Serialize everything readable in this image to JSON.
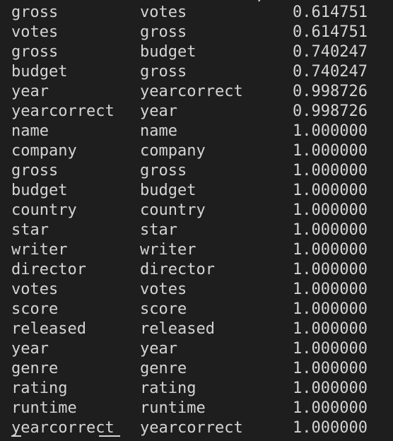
{
  "rows": [
    {
      "var1": "gross",
      "var2": "votes",
      "corr": "0.614751"
    },
    {
      "var1": "votes",
      "var2": "gross",
      "corr": "0.614751"
    },
    {
      "var1": "gross",
      "var2": "budget",
      "corr": "0.740247"
    },
    {
      "var1": "budget",
      "var2": "gross",
      "corr": "0.740247"
    },
    {
      "var1": "year",
      "var2": "yearcorrect",
      "corr": "0.998726"
    },
    {
      "var1": "yearcorrect",
      "var2": "year",
      "corr": "0.998726"
    },
    {
      "var1": "name",
      "var2": "name",
      "corr": "1.000000"
    },
    {
      "var1": "company",
      "var2": "company",
      "corr": "1.000000"
    },
    {
      "var1": "gross",
      "var2": "gross",
      "corr": "1.000000"
    },
    {
      "var1": "budget",
      "var2": "budget",
      "corr": "1.000000"
    },
    {
      "var1": "country",
      "var2": "country",
      "corr": "1.000000"
    },
    {
      "var1": "star",
      "var2": "star",
      "corr": "1.000000"
    },
    {
      "var1": "writer",
      "var2": "writer",
      "corr": "1.000000"
    },
    {
      "var1": "director",
      "var2": "director",
      "corr": "1.000000"
    },
    {
      "var1": "votes",
      "var2": "votes",
      "corr": "1.000000"
    },
    {
      "var1": "score",
      "var2": "score",
      "corr": "1.000000"
    },
    {
      "var1": "released",
      "var2": "released",
      "corr": "1.000000"
    },
    {
      "var1": "year",
      "var2": "year",
      "corr": "1.000000"
    },
    {
      "var1": "genre",
      "var2": "genre",
      "corr": "1.000000"
    },
    {
      "var1": "rating",
      "var2": "rating",
      "corr": "1.000000"
    },
    {
      "var1": "runtime",
      "var2": "runtime",
      "corr": "1.000000"
    },
    {
      "var1": "yearcorrect",
      "var2": "yearcorrect",
      "corr": "1.000000"
    }
  ],
  "colors": {
    "background": "#1e1e1e",
    "text": "#d4d4d4"
  }
}
